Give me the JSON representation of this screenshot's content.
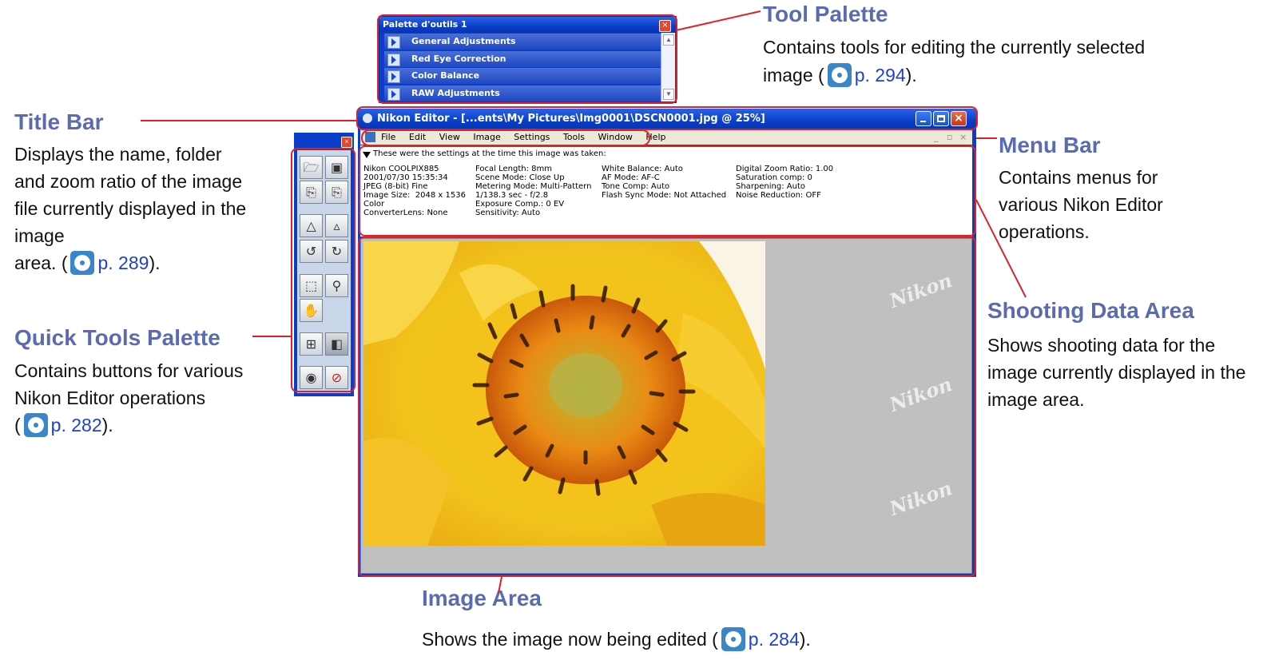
{
  "annotations": {
    "tool_palette": {
      "title": "Tool Palette",
      "desc_a": "Contains tools for editing the currently selected",
      "desc_b": "image (",
      "page": "p. 294",
      "desc_end": ")."
    },
    "title_bar": {
      "title": "Title Bar",
      "desc": "Displays the name,  folder and zoom ratio of the image file currently displayed in the image",
      "desc_b": "area. (",
      "page": "p. 289",
      "desc_end": ")."
    },
    "menu_bar": {
      "title": "Menu Bar",
      "desc": "Contains menus for various Nikon Editor operations."
    },
    "quick_tools": {
      "title": "Quick Tools Palette",
      "desc": "Contains buttons for various Nikon Editor operations",
      "desc_b": "(",
      "page": "p. 282",
      "desc_end": ")."
    },
    "shooting_data": {
      "title": "Shooting Data Area",
      "desc": "Shows shooting data for the image currently displayed in the image area."
    },
    "image_area": {
      "title": "Image Area",
      "desc_a": "Shows the image now being edited (",
      "page": "p. 284",
      "desc_end": ")."
    }
  },
  "tool_palette": {
    "title": "Palette d'outils 1",
    "items": [
      {
        "label": "General Adjustments"
      },
      {
        "label": "Red Eye Correction"
      },
      {
        "label": "Color Balance"
      },
      {
        "label": "RAW Adjustments"
      }
    ]
  },
  "editor": {
    "title": "Nikon Editor - [...ents\\My Pictures\\Img0001\\DSCN0001.jpg @ 25%]",
    "menu": [
      "File",
      "Edit",
      "View",
      "Image",
      "Settings",
      "Tools",
      "Window",
      "Help"
    ],
    "shooting_header": "These were the settings at the time this image was taken:",
    "shooting_columns": [
      "Nikon COOLPIX885\n2001/07/30 15:35:34\nJPEG (8-bit) Fine\nImage Size:  2048 x 1536\nColor\nConverterLens: None",
      "Focal Length: 8mm\nScene Mode: Close Up\nMetering Mode: Multi-Pattern\n1/138.3 sec - f/2.8\nExposure Comp.: 0 EV\nSensitivity: Auto",
      "White Balance: Auto\nAF Mode: AF-C\nTone Comp: Auto\nFlash Sync Mode: Not Attached",
      "Digital Zoom Ratio: 1.00\nSaturation comp: 0\nSharpening: Auto\nNoise Reduction: OFF"
    ],
    "watermark": "Nikon"
  },
  "quick_tools": {
    "buttons": [
      "open-icon",
      "save-icon",
      "copy-icon",
      "paste-icon",
      "zoom-out-mountain-icon",
      "zoom-in-mountain-icon",
      "rotate-left-icon",
      "rotate-right-icon",
      "marquee-icon",
      "magnifier-icon",
      "hand-icon",
      "grid-icon",
      "preview-icon",
      "eye-icon",
      "cancel-icon"
    ]
  },
  "colors": {
    "accent_red": "#e0202a",
    "title_blue": "#5b6bb0",
    "link_blue": "#1f3fd6"
  }
}
